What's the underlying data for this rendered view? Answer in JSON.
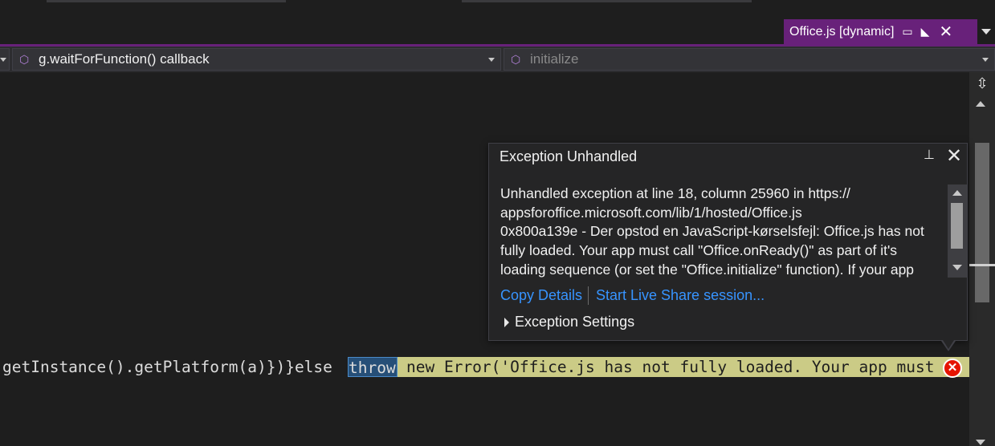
{
  "document_tab": {
    "title": "Office.js [dynamic]",
    "pin_icon": "pin-icon",
    "float_icon": "float-window-icon",
    "close_icon": "close-icon"
  },
  "navigation_bar": {
    "left_combo": "",
    "middle_combo": "g.waitForFunction() callback",
    "right_combo": "initialize"
  },
  "editor": {
    "code_prefix": "getInstance().getPlatform(a)})}else ",
    "code_selected": "throw",
    "code_suffix": "new Error('Office.js has not fully loaded. Your app must ca"
  },
  "exception_popup": {
    "title": "Exception Unhandled",
    "message_lines": [
      "Unhandled exception at line 18, column 25960 in https://",
      "appsforoffice.microsoft.com/lib/1/hosted/Office.js",
      "0x800a139e - Der opstod en JavaScript-kørselsfejl: Office.js has not",
      "fully loaded. Your app must call \"Office.onReady()\" as part of it's",
      "loading sequence (or set the \"Office.initialize\" function). If your app"
    ],
    "copy_details": "Copy Details",
    "live_share": "Start Live Share session...",
    "settings": "Exception Settings"
  },
  "colors": {
    "accent_purple": "#68217a",
    "link": "#3794ff",
    "highlight": "#cbcb86",
    "error": "#e51400"
  }
}
